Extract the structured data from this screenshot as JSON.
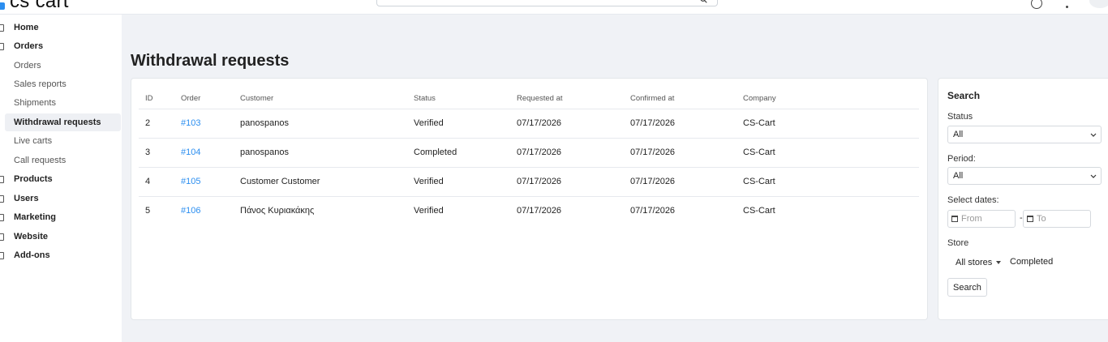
{
  "header": {
    "logo_text": "cs cart",
    "search_placeholder": "",
    "icons": [
      "search-icon",
      "help-icon",
      "more-icon",
      "avatar"
    ]
  },
  "sidebar": {
    "items": [
      {
        "label": "Home",
        "type": "section",
        "icon": "home-icon"
      },
      {
        "label": "Orders",
        "type": "section",
        "icon": "orders-icon"
      },
      {
        "label": "Orders",
        "type": "sub"
      },
      {
        "label": "Sales reports",
        "type": "sub"
      },
      {
        "label": "Shipments",
        "type": "sub"
      },
      {
        "label": "Withdrawal requests",
        "type": "sub",
        "active": true
      },
      {
        "label": "Live carts",
        "type": "sub"
      },
      {
        "label": "Call requests",
        "type": "sub"
      },
      {
        "label": "Products",
        "type": "section",
        "icon": "products-icon"
      },
      {
        "label": "Users",
        "type": "section",
        "icon": "users-icon"
      },
      {
        "label": "Marketing",
        "type": "section",
        "icon": "marketing-icon"
      },
      {
        "label": "Website",
        "type": "section",
        "icon": "website-icon"
      },
      {
        "label": "Add-ons",
        "type": "section",
        "icon": "addons-icon"
      }
    ]
  },
  "main": {
    "title": "Withdrawal requests",
    "table": {
      "columns": [
        "ID",
        "Order",
        "Customer",
        "Status",
        "Requested at",
        "Confirmed at",
        "Company"
      ],
      "rows": [
        [
          "2",
          "#103",
          "panospanos",
          "Verified",
          "07/17/2026",
          "07/17/2026",
          "CS-Cart"
        ],
        [
          "3",
          "#104",
          "panospanos",
          "Completed",
          "07/17/2026",
          "07/17/2026",
          "CS-Cart"
        ],
        [
          "4",
          "#105",
          "Customer Customer",
          "Verified",
          "07/17/2026",
          "07/17/2026",
          "CS-Cart"
        ],
        [
          "5",
          "#106",
          "Πάνος Κυριακάκης",
          "Verified",
          "07/17/2026",
          "07/17/2026",
          "CS-Cart"
        ]
      ]
    }
  },
  "filter": {
    "title": "Search",
    "status_label": "Status",
    "status_value": "All",
    "period_label": "Period:",
    "period_value": "All",
    "dates_label": "Select dates:",
    "from_placeholder": "From",
    "to_placeholder": "To",
    "date_separator": "-",
    "store_label": "Store",
    "store_value": "All stores",
    "store_status": "Completed",
    "search_button": "Search"
  },
  "colors": {
    "link": "#2b8ef0",
    "main_bg": "#f0f2f6",
    "active_nav_bg": "#eef0f4"
  }
}
